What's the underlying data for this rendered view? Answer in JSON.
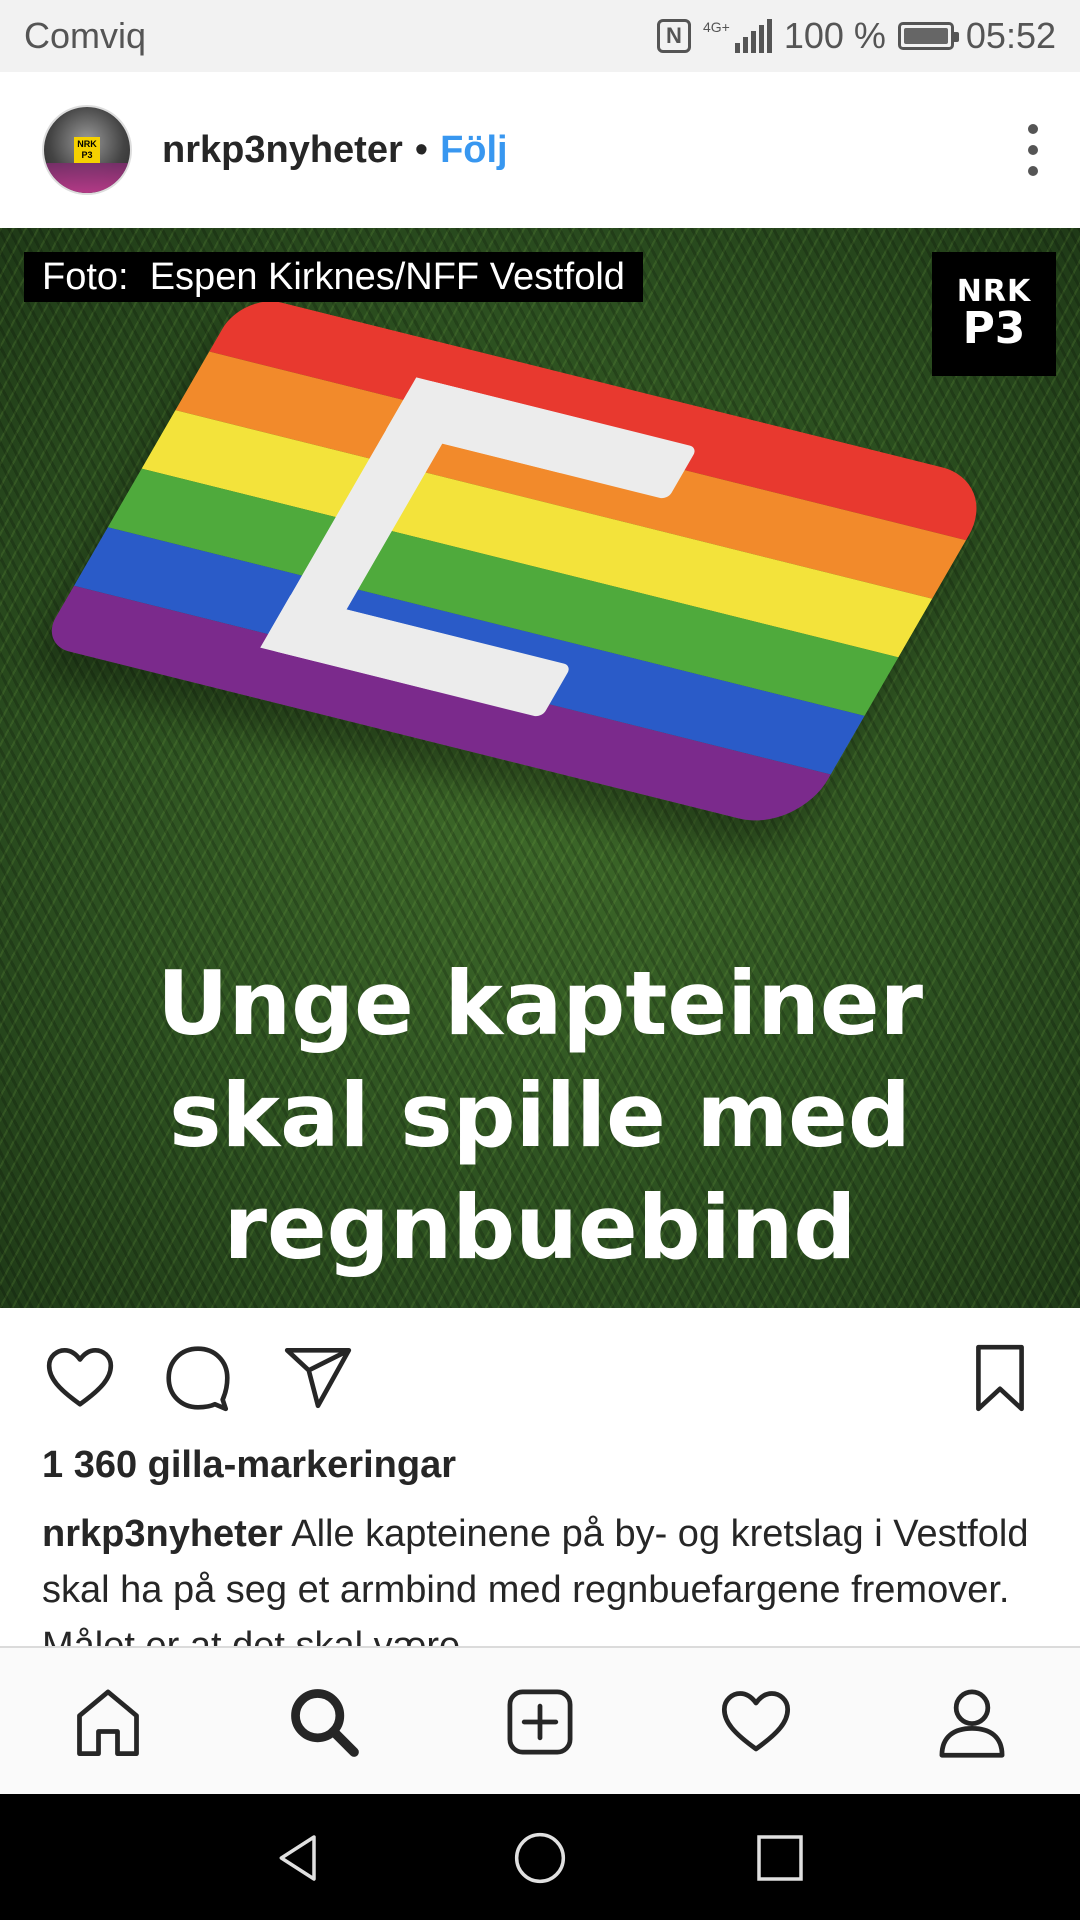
{
  "status_bar": {
    "carrier": "Comviq",
    "network": "4G+",
    "battery": "100 %",
    "time": "05:52"
  },
  "post": {
    "username": "nrkp3nyheter",
    "separator": "•",
    "follow_label": "Följ",
    "avatar_badge": "NRK P3",
    "image": {
      "photo_credit": "Foto:  Espen Kirknes/NFF Vestfold",
      "logo_line1": "NRK",
      "logo_line2": "P3",
      "headline": [
        "Unge kapteiner",
        "skal spille med",
        "regnbuebind"
      ],
      "armband_letter": "C",
      "rainbow_colors": [
        "#e8392f",
        "#f28a2b",
        "#f3e33b",
        "#4faa3c",
        "#2a5bc8",
        "#7b2a8c"
      ]
    },
    "likes": "1 360 gilla-markeringar",
    "caption_user": "nrkp3nyheter",
    "caption_text": "Alle kapteinene på by- og kretslag i Vestfold skal ha på seg et armbind med regnbuefargene fremover. Målet er at det skal være"
  },
  "actions": {
    "like_icon": "heart-icon",
    "comment_icon": "comment-icon",
    "share_icon": "send-icon",
    "save_icon": "bookmark-icon"
  },
  "bottom_nav": {
    "items": [
      "home-icon",
      "search-icon",
      "add-icon",
      "activity-heart-icon",
      "profile-icon"
    ]
  },
  "colors": {
    "follow_blue": "#3897f0",
    "text": "#262626"
  }
}
